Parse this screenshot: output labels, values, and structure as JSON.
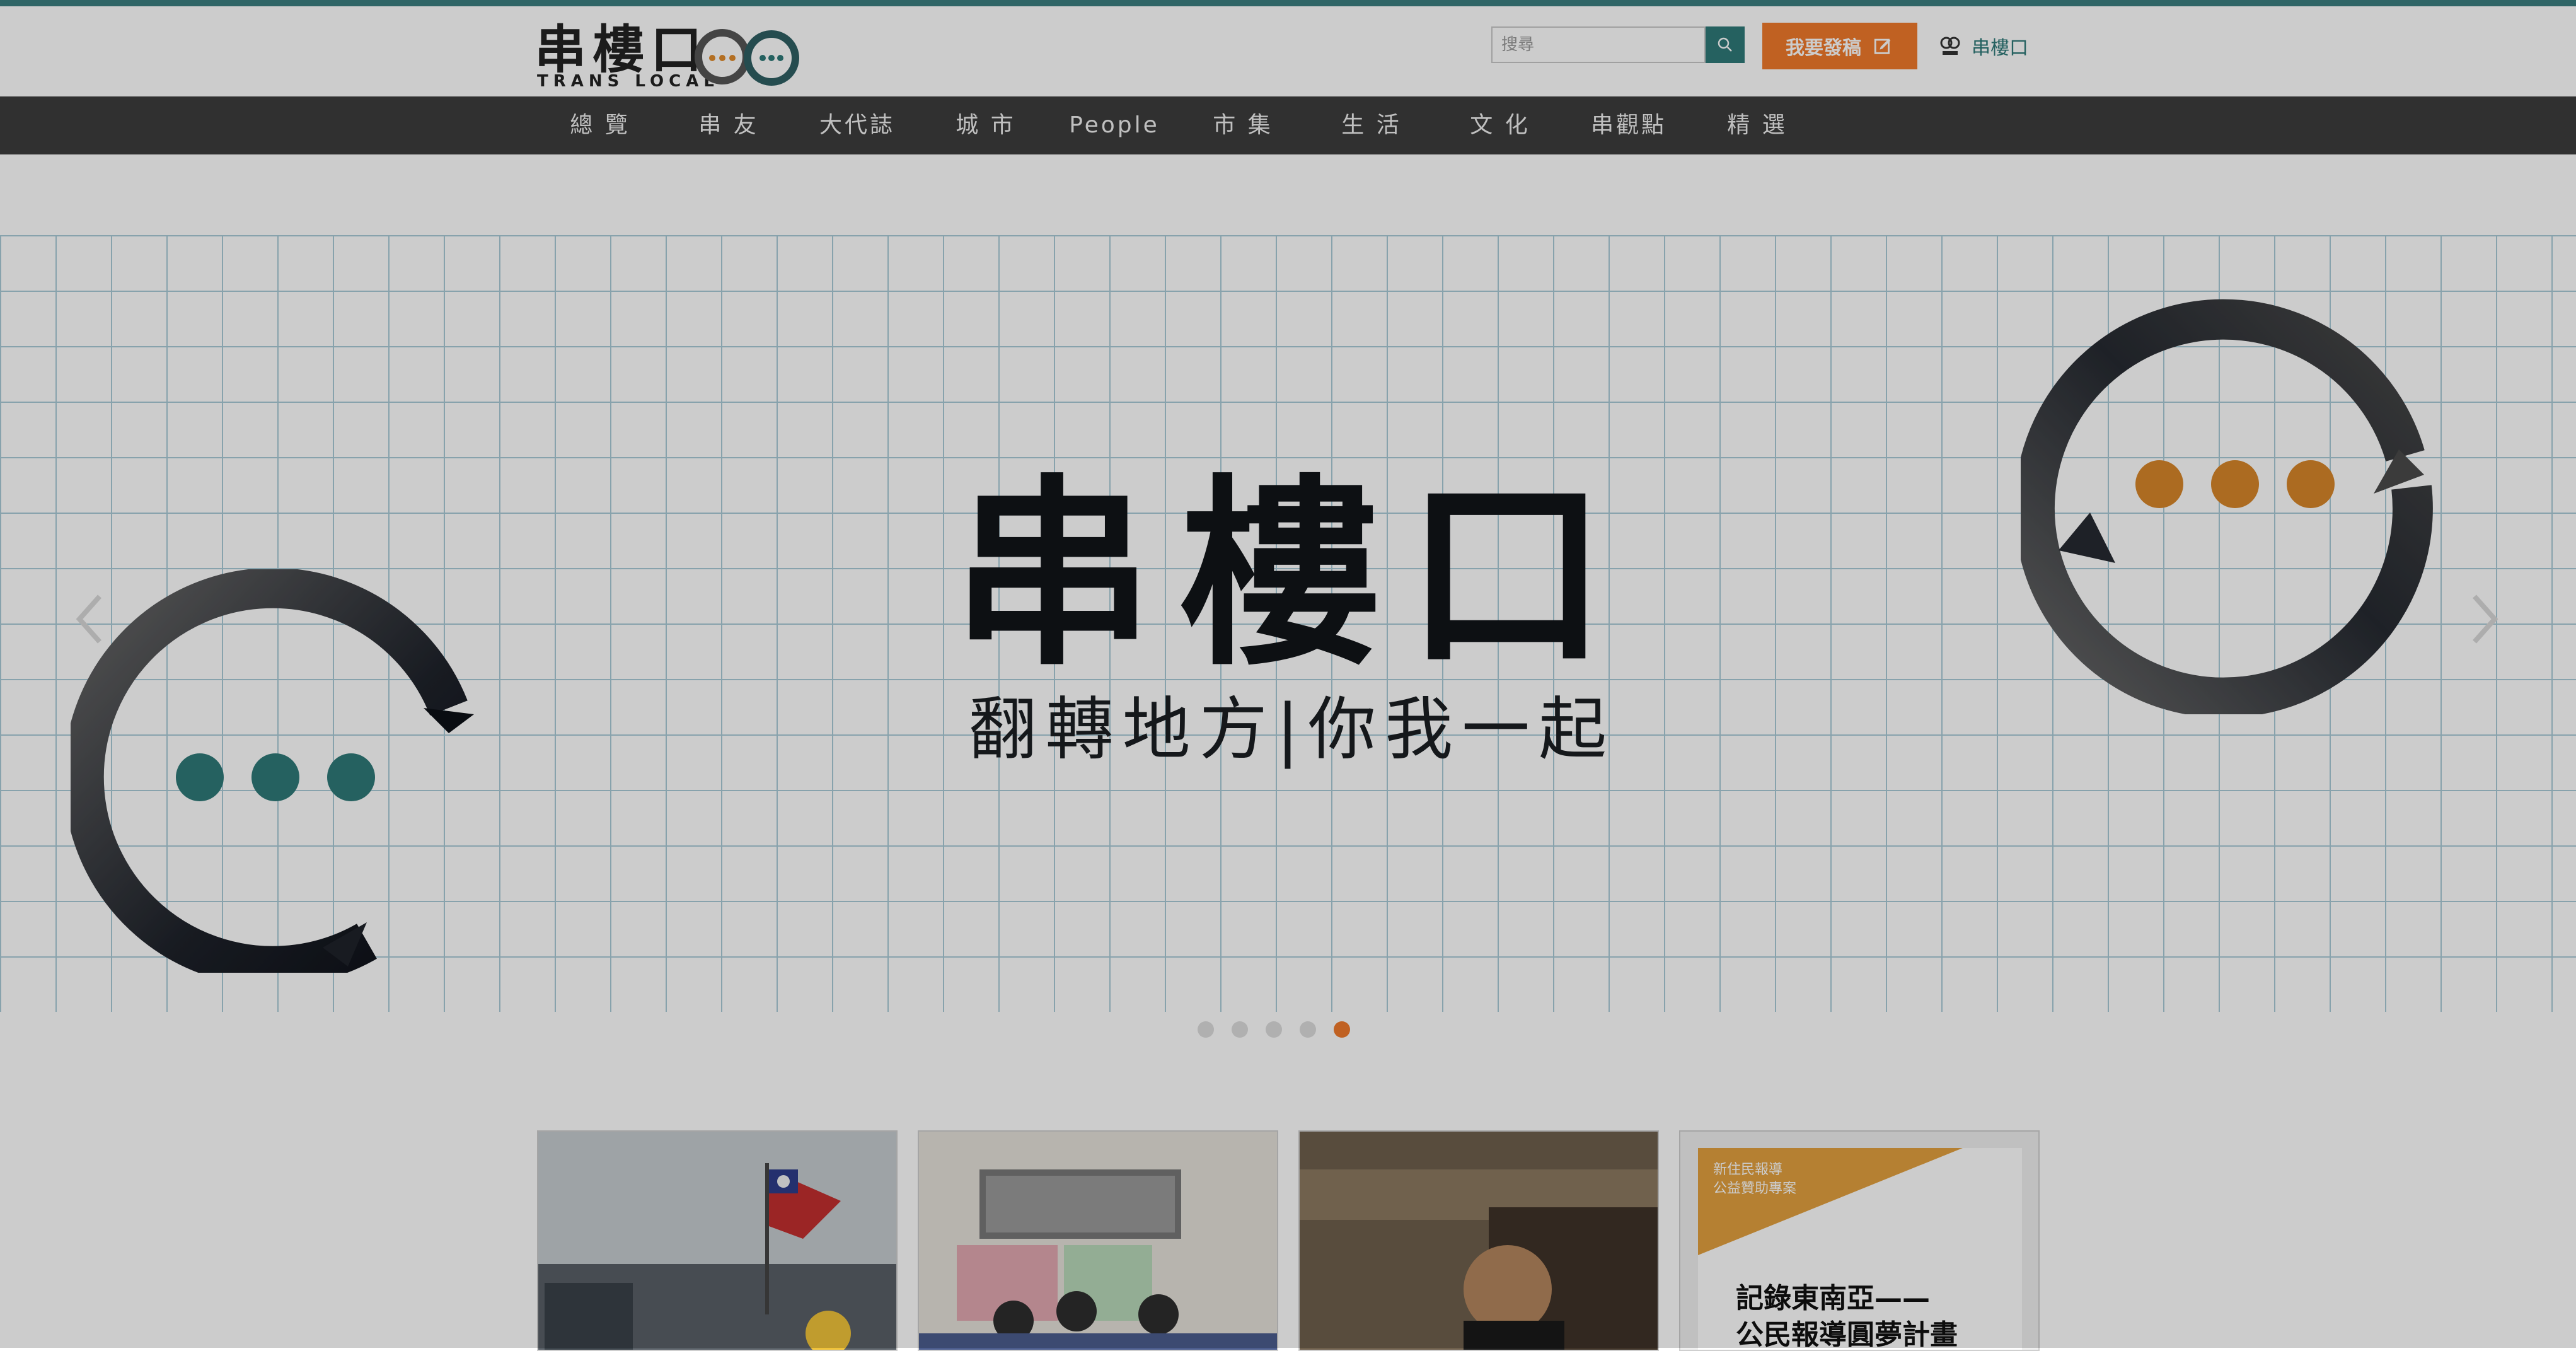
{
  "brand": {
    "name_cn": "串樓口",
    "name_en": "TRANS LOCAL",
    "accent_color": "#2f7a79",
    "orange_color": "#f07a2b"
  },
  "header": {
    "search": {
      "placeholder": "搜尋",
      "value": ""
    },
    "contribute_label": "我要發稿",
    "brand_link_label": "串樓口"
  },
  "nav": {
    "items": [
      {
        "label": "總 覽"
      },
      {
        "label": "串 友"
      },
      {
        "label": "大代誌"
      },
      {
        "label": "城 市"
      },
      {
        "label": "People"
      },
      {
        "label": "市 集"
      },
      {
        "label": "生 活"
      },
      {
        "label": "文 化"
      },
      {
        "label": "串觀點"
      },
      {
        "label": "精 選"
      }
    ]
  },
  "hero": {
    "title": "串樓口",
    "subtitle": "翻轉地方|你我一起",
    "slides_total": 5,
    "active_slide_index": 4,
    "icons": {
      "left": "chat-bubble-icon",
      "right": "chat-bubble-icon"
    }
  },
  "cards": [
    {
      "name": "protest-photo-card"
    },
    {
      "name": "workshop-photo-card"
    },
    {
      "name": "person-photo-card"
    },
    {
      "name": "promo-card",
      "tag_line1": "新住民報導",
      "tag_line2": "公益贊助專案",
      "title_line1": "記錄東南亞——",
      "title_line2": "公民報導圓夢計畫"
    }
  ]
}
